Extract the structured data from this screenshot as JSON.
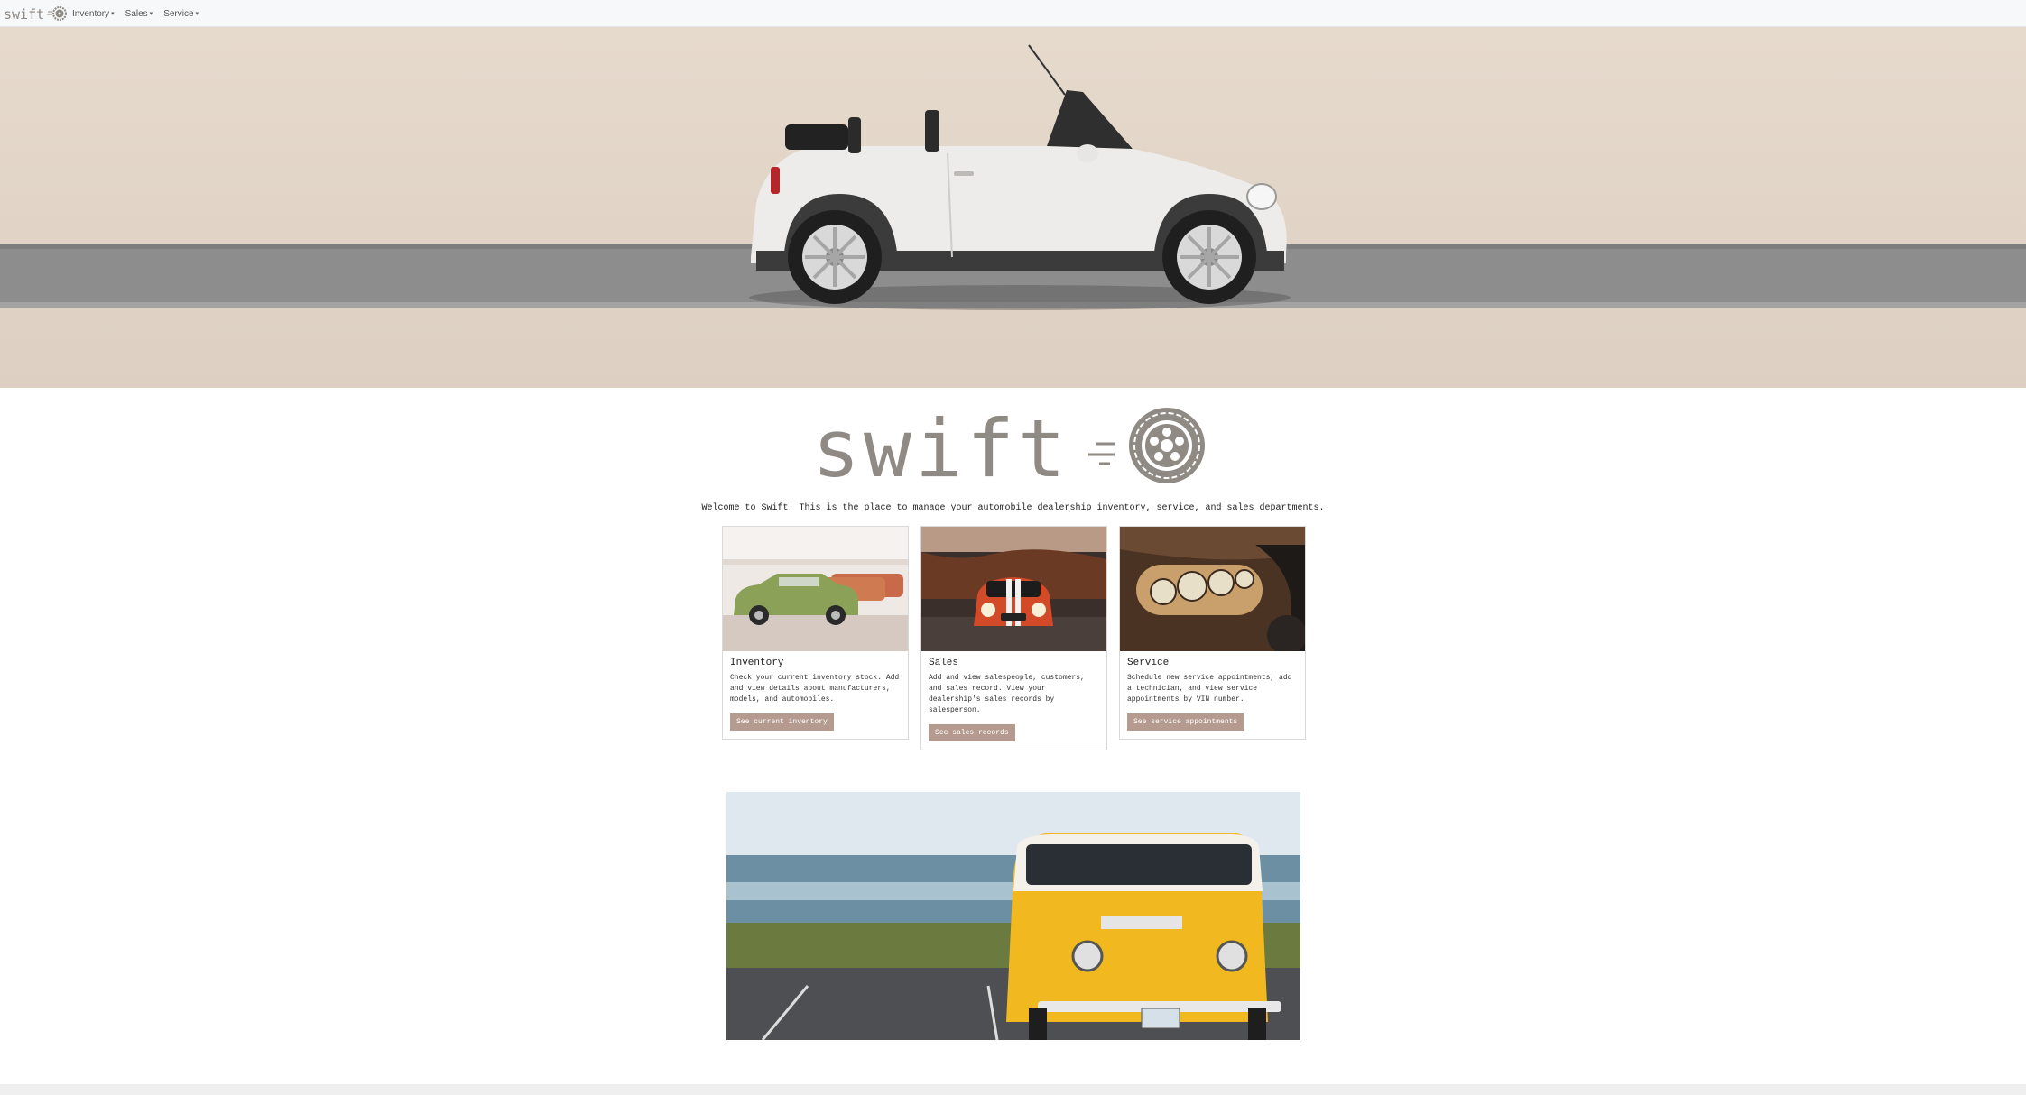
{
  "brand": {
    "name": "swift"
  },
  "nav": {
    "items": [
      {
        "label": "Inventory"
      },
      {
        "label": "Sales"
      },
      {
        "label": "Service"
      }
    ]
  },
  "welcome": "Welcome to Swift! This is the place to manage your automobile dealership inventory, service, and sales departments.",
  "cards": [
    {
      "title": "Inventory",
      "text": "Check your current inventory stock. Add and view details about manufacturers, models, and automobiles.",
      "button": "See current inventory"
    },
    {
      "title": "Sales",
      "text": "Add and view salespeople, customers, and sales record. View your dealership's sales records by salesperson.",
      "button": "See sales records"
    },
    {
      "title": "Service",
      "text": "Schedule new service appointments, add a technician, and view service appointments by VIN number.",
      "button": "See service appointments"
    }
  ],
  "colors": {
    "brand_gray": "#8f8a84",
    "button": "#b59b8f",
    "navbar_bg": "#f7f8fa"
  }
}
